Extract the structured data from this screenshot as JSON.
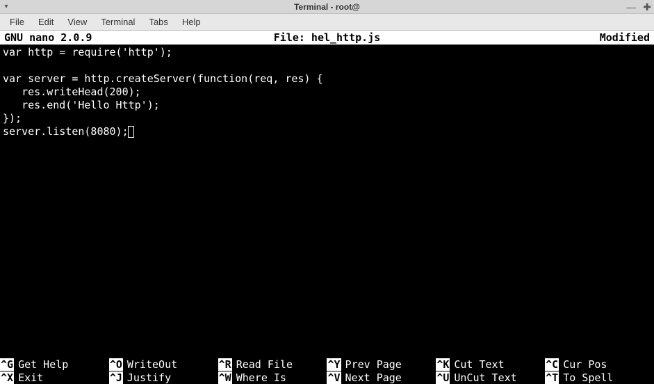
{
  "titlebar": {
    "title": "Terminal - root@"
  },
  "menubar": {
    "items": [
      "File",
      "Edit",
      "View",
      "Terminal",
      "Tabs",
      "Help"
    ]
  },
  "nano": {
    "version": "GNU nano 2.0.9",
    "file_label": "File: hel_http.js",
    "modified": "Modified"
  },
  "editor": {
    "lines": [
      "var http = require('http');",
      "",
      "var server = http.createServer(function(req, res) {",
      "   res.writeHead(200);",
      "   res.end('Hello Http');",
      "});",
      "server.listen(8080);"
    ]
  },
  "shortcuts": {
    "row1": [
      {
        "key": "^G",
        "label": "Get Help"
      },
      {
        "key": "^O",
        "label": "WriteOut"
      },
      {
        "key": "^R",
        "label": "Read File"
      },
      {
        "key": "^Y",
        "label": "Prev Page"
      },
      {
        "key": "^K",
        "label": "Cut Text"
      },
      {
        "key": "^C",
        "label": "Cur Pos"
      }
    ],
    "row2": [
      {
        "key": "^X",
        "label": "Exit"
      },
      {
        "key": "^J",
        "label": "Justify"
      },
      {
        "key": "^W",
        "label": "Where Is"
      },
      {
        "key": "^V",
        "label": "Next Page"
      },
      {
        "key": "^U",
        "label": "UnCut Text"
      },
      {
        "key": "^T",
        "label": "To Spell"
      }
    ]
  }
}
